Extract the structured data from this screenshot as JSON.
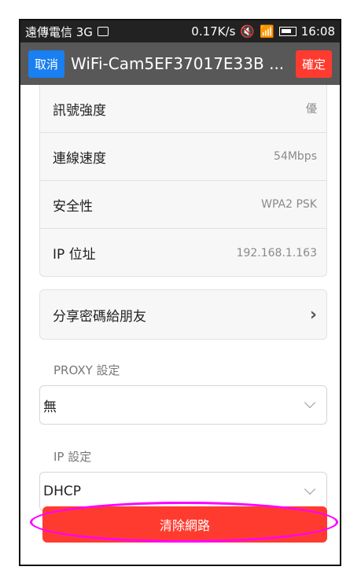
{
  "status_bar": {
    "carrier": "遠傳電信 3G",
    "speed": "0.17K/s",
    "time": "16:08",
    "icons": [
      "image-icon",
      "mute-icon",
      "wifi-icon",
      "signal-icon",
      "battery-icon"
    ]
  },
  "titlebar": {
    "cancel_label": "取消",
    "title": "WiFi-Cam5EF37017E33B ...",
    "confirm_label": "確定"
  },
  "info": {
    "rows": [
      {
        "label": "訊號強度",
        "value": "優"
      },
      {
        "label": "連線速度",
        "value": "54Mbps"
      },
      {
        "label": "安全性",
        "value": "WPA2 PSK"
      },
      {
        "label": "IP 位址",
        "value": "192.168.1.163"
      }
    ]
  },
  "share": {
    "label": "分享密碼給朋友"
  },
  "proxy": {
    "section_label": "PROXY 設定",
    "selected": "無"
  },
  "ip": {
    "section_label": "IP 設定",
    "selected": "DHCP"
  },
  "clear_button": {
    "label": "清除網路"
  },
  "colors": {
    "accent_blue": "#1a7ff0",
    "accent_red": "#ff3b30",
    "highlight": "#ff00ff"
  }
}
